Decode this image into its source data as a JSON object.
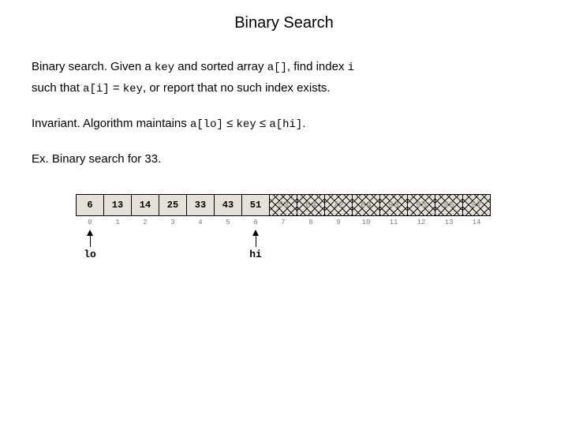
{
  "title": "Binary Search",
  "p1": {
    "lead": "Binary search.",
    "t1": "  Given a ",
    "c1": "key",
    "t2": " and sorted array ",
    "c2": "a[]",
    "t3": ", find index ",
    "c3": "i",
    "t4": "such that ",
    "c4": "a[i]",
    "t5": " = ",
    "c5": "key",
    "t6": ", or report that no such index exists."
  },
  "p2": {
    "lead": "Invariant.",
    "t1": "  Algorithm maintains ",
    "c1": "a[lo]",
    "le1": " ≤ ",
    "c2": "key",
    "le2": " ≤ ",
    "c3": "a[hi]",
    "t2": "."
  },
  "p3": {
    "lead": "Ex.",
    "t1": "  Binary search for 33."
  },
  "array": {
    "values": [
      "6",
      "13",
      "14",
      "25",
      "33",
      "43",
      "51",
      "53",
      "64",
      "72",
      "84",
      "93",
      "95",
      "96",
      "97"
    ],
    "indices": [
      "0",
      "1",
      "2",
      "3",
      "4",
      "5",
      "6",
      "7",
      "8",
      "9",
      "10",
      "11",
      "12",
      "13",
      "14"
    ],
    "lo_index": 0,
    "hi_index": 6,
    "lo_label": "lo",
    "hi_label": "hi"
  }
}
